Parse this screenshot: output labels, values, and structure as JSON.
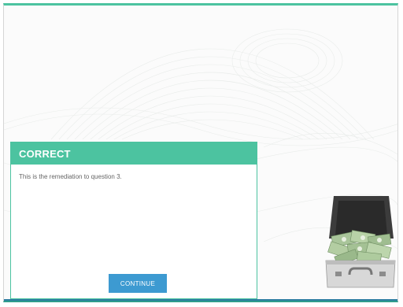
{
  "dialog": {
    "title": "CORRECT",
    "message": "This is the remediation to question 3.",
    "continue_label": "CONTINUE"
  },
  "colors": {
    "accent": "#4cc3a0",
    "button": "#3d9ad1",
    "body_text": "#666666"
  },
  "icons": [
    "money-briefcase-illustration"
  ]
}
